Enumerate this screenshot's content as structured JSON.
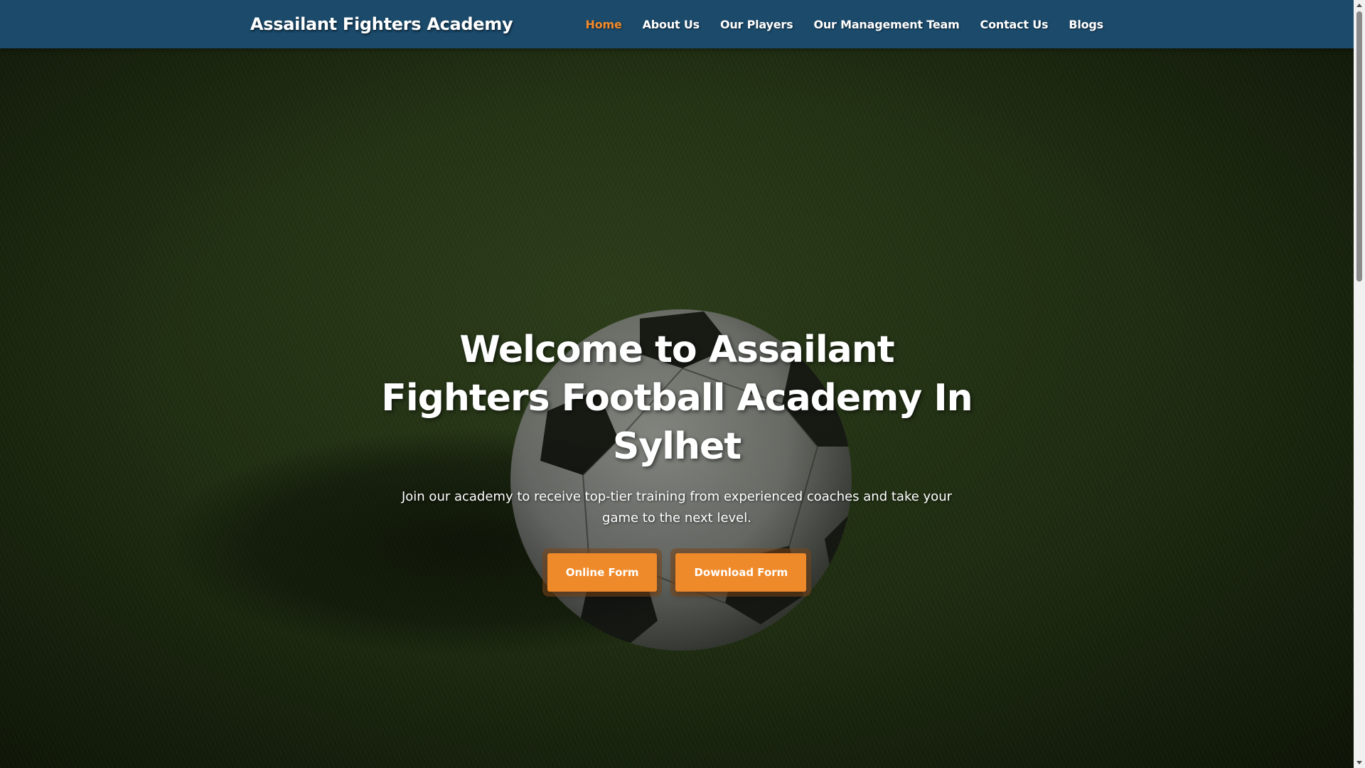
{
  "navbar": {
    "brand": "Assailant Fighters Academy",
    "items": [
      {
        "label": "Home",
        "active": true
      },
      {
        "label": "About Us",
        "active": false
      },
      {
        "label": "Our Players",
        "active": false
      },
      {
        "label": "Our Management Team",
        "active": false
      },
      {
        "label": "Contact Us",
        "active": false
      },
      {
        "label": "Blogs",
        "active": false
      }
    ]
  },
  "hero": {
    "title": "Welcome to Assailant Fighters Football Academy In Sylhet",
    "text": "Join our academy to receive top-tier training from experienced coaches and take your game to the next level.",
    "buttons": {
      "online_form": "Online Form",
      "download_form": "Download Form"
    },
    "background_image": "soccer-ball-on-grass"
  },
  "colors": {
    "navbar": "#1b4a6b",
    "accent": "#ef8a2b",
    "active_link": "#f08a2b",
    "text": "#ffffff"
  }
}
